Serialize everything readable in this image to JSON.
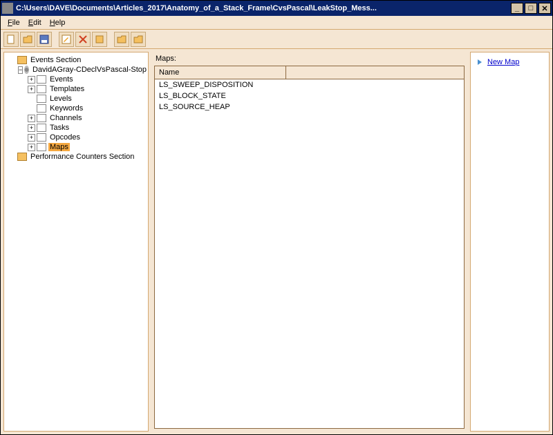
{
  "window": {
    "title": "C:\\Users\\DAVE\\Documents\\Articles_2017\\Anatomy_of_a_Stack_Frame\\CvsPascal\\LeakStop_Mess..."
  },
  "menu": {
    "file": "File",
    "edit": "Edit",
    "help": "Help"
  },
  "tree": {
    "events_section": "Events Section",
    "provider": "DavidAGray-CDeclVsPascal-Stop",
    "events": "Events",
    "templates": "Templates",
    "levels": "Levels",
    "keywords": "Keywords",
    "channels": "Channels",
    "tasks": "Tasks",
    "opcodes": "Opcodes",
    "maps": "Maps",
    "perf": "Performance Counters Section"
  },
  "main": {
    "label": "Maps:",
    "header": "Name",
    "rows": [
      "LS_SWEEP_DISPOSITION",
      "LS_BLOCK_STATE",
      "LS_SOURCE_HEAP"
    ]
  },
  "actions": {
    "new_map": "New Map"
  }
}
